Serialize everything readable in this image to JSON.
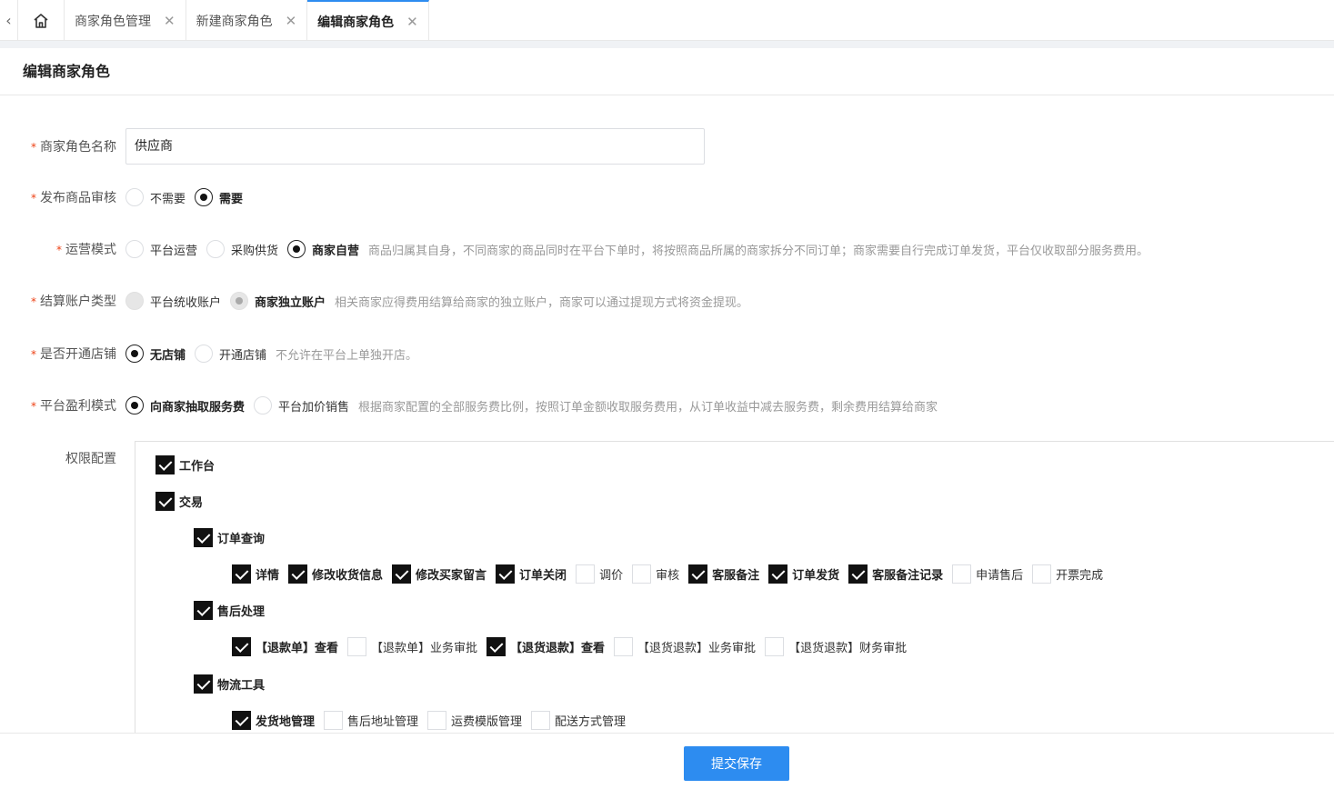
{
  "tabs": {
    "home_icon": "home-icon",
    "items": [
      {
        "label": "商家角色管理",
        "close": "✕"
      },
      {
        "label": "新建商家角色",
        "close": "✕"
      },
      {
        "label": "编辑商家角色",
        "close": "✕"
      }
    ],
    "active_color": "#2d8cf0"
  },
  "page": {
    "title": "编辑商家角色"
  },
  "form": {
    "required_mark": "*",
    "name": {
      "label": "商家角色名称",
      "value": "供应商"
    },
    "review": {
      "label": "发布商品审核",
      "options": [
        "不需要",
        "需要"
      ],
      "selected": "需要"
    },
    "operation": {
      "label": "运营模式",
      "options": [
        "平台运营",
        "采购供货",
        "商家自营"
      ],
      "selected": "商家自营",
      "hint": "商品归属其自身，不同商家的商品同时在平台下单时，将按照商品所属的商家拆分不同订单；商家需要自行完成订单发货，平台仅收取部分服务费用。"
    },
    "settlement": {
      "label": "结算账户类型",
      "options": [
        "平台统收账户",
        "商家独立账户"
      ],
      "selected": "商家独立账户",
      "disabled": true,
      "hint": "相关商家应得费用结算给商家的独立账户，商家可以通过提现方式将资金提现。"
    },
    "store": {
      "label": "是否开通店铺",
      "options": [
        "无店铺",
        "开通店铺"
      ],
      "selected": "无店铺",
      "hint": "不允许在平台上单独开店。"
    },
    "profit": {
      "label": "平台盈利模式",
      "options": [
        "向商家抽取服务费",
        "平台加价销售"
      ],
      "selected": "向商家抽取服务费",
      "hint": "根据商家配置的全部服务费比例，按照订单金额收取服务费用，从订单收益中减去服务费，剩余费用结算给商家"
    },
    "permissions": {
      "label": "权限配置",
      "workbench": {
        "label": "工作台",
        "checked": true
      },
      "trade": {
        "label": "交易",
        "checked": true
      },
      "order_query": {
        "label": "订单查询",
        "checked": true,
        "items": [
          {
            "label": "详情",
            "checked": true
          },
          {
            "label": "修改收货信息",
            "checked": true
          },
          {
            "label": "修改买家留言",
            "checked": true
          },
          {
            "label": "订单关闭",
            "checked": true
          },
          {
            "label": "调价",
            "checked": false
          },
          {
            "label": "审核",
            "checked": false
          },
          {
            "label": "客服备注",
            "checked": true
          },
          {
            "label": "订单发货",
            "checked": true
          },
          {
            "label": "客服备注记录",
            "checked": true
          },
          {
            "label": "申请售后",
            "checked": false
          },
          {
            "label": "开票完成",
            "checked": false
          }
        ]
      },
      "after_sale": {
        "label": "售后处理",
        "checked": true,
        "items": [
          {
            "label": "【退款单】查看",
            "checked": true
          },
          {
            "label": "【退款单】业务审批",
            "checked": false
          },
          {
            "label": "【退货退款】查看",
            "checked": true
          },
          {
            "label": "【退货退款】业务审批",
            "checked": false
          },
          {
            "label": "【退货退款】财务审批",
            "checked": false
          }
        ]
      },
      "logistics": {
        "label": "物流工具",
        "checked": true,
        "items": [
          {
            "label": "发货地管理",
            "checked": true
          },
          {
            "label": "售后地址管理",
            "checked": false
          },
          {
            "label": "运费模版管理",
            "checked": false
          },
          {
            "label": "配送方式管理",
            "checked": false
          }
        ]
      }
    }
  },
  "footer": {
    "submit_label": "提交保存"
  }
}
